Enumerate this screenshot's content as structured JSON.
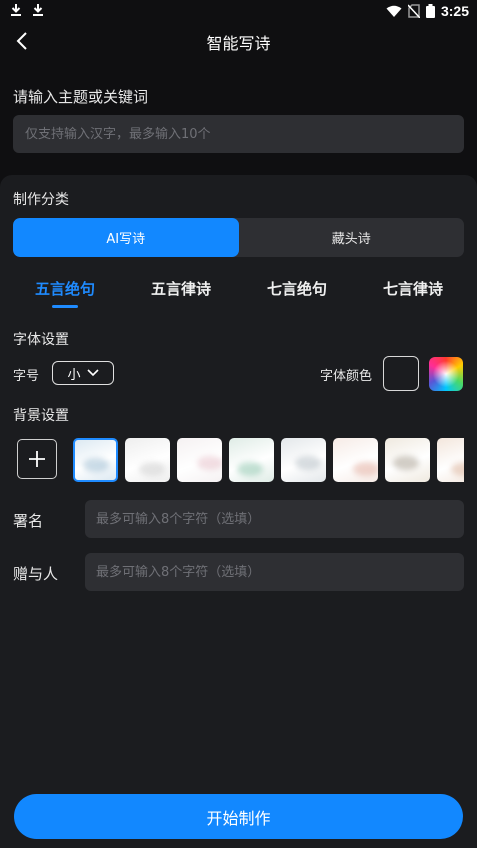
{
  "status_bar": {
    "time": "3:25",
    "left_icons": [
      "download-icon",
      "download-icon"
    ],
    "right_icons": [
      "wifi-icon",
      "no-sim-icon",
      "battery-icon"
    ]
  },
  "header": {
    "title": "智能写诗",
    "back_icon": "chevron-left-icon"
  },
  "topic": {
    "label": "请输入主题或关键词",
    "placeholder": "仅支持输入汉字，最多输入10个",
    "value": ""
  },
  "category": {
    "label": "制作分类",
    "options": [
      {
        "label": "AI写诗",
        "active": true
      },
      {
        "label": "藏头诗",
        "active": false
      }
    ]
  },
  "poem_types": {
    "selected": "五言绝句",
    "tabs": [
      {
        "label": "五言绝句",
        "active": true
      },
      {
        "label": "五言律诗",
        "active": false
      },
      {
        "label": "七言绝句",
        "active": false
      },
      {
        "label": "七言律诗",
        "active": false
      }
    ]
  },
  "font_settings": {
    "label": "字体设置",
    "size_label": "字号",
    "size_value": "小",
    "size_dropdown_icon": "chevron-down-icon",
    "color_label": "字体颜色",
    "color_options": [
      "white-swatch",
      "rainbow-color-picker"
    ],
    "selected_color": "#ffffff"
  },
  "background": {
    "label": "背景设置",
    "add_icon": "plus-icon",
    "selected_index": 0,
    "thumbnails": [
      {
        "name": "blue-ink-landscape",
        "base": "#dce9f2",
        "accent": "#8fb3cc"
      },
      {
        "name": "pale-grey-mist",
        "base": "#eeeeee",
        "accent": "#c8c8c8"
      },
      {
        "name": "pink-blossom",
        "base": "#f5f1f2",
        "accent": "#e4b8c2"
      },
      {
        "name": "green-bamboo",
        "base": "#dfece6",
        "accent": "#7fbfa3"
      },
      {
        "name": "grey-mountains",
        "base": "#e3e7ea",
        "accent": "#a9b4bc"
      },
      {
        "name": "peach-flowers",
        "base": "#f6ebe6",
        "accent": "#e0a596"
      },
      {
        "name": "cream-ink-birds",
        "base": "#efe9df",
        "accent": "#9c9282"
      },
      {
        "name": "warm-paper",
        "base": "#f3e6dc",
        "accent": "#d7a98e"
      }
    ]
  },
  "signature": {
    "label": "署名",
    "placeholder": "最多可输入8个字符（选填）",
    "value": ""
  },
  "recipient": {
    "label": "赠与人",
    "placeholder": "最多可输入8个字符（选填）",
    "value": ""
  },
  "actions": {
    "start_label": "开始制作"
  },
  "colors": {
    "background": "#0f0f11",
    "panel": "#1b1c1f",
    "input": "#2e2f33",
    "accent": "#1288ff",
    "active_tab": "#1f8bff"
  }
}
